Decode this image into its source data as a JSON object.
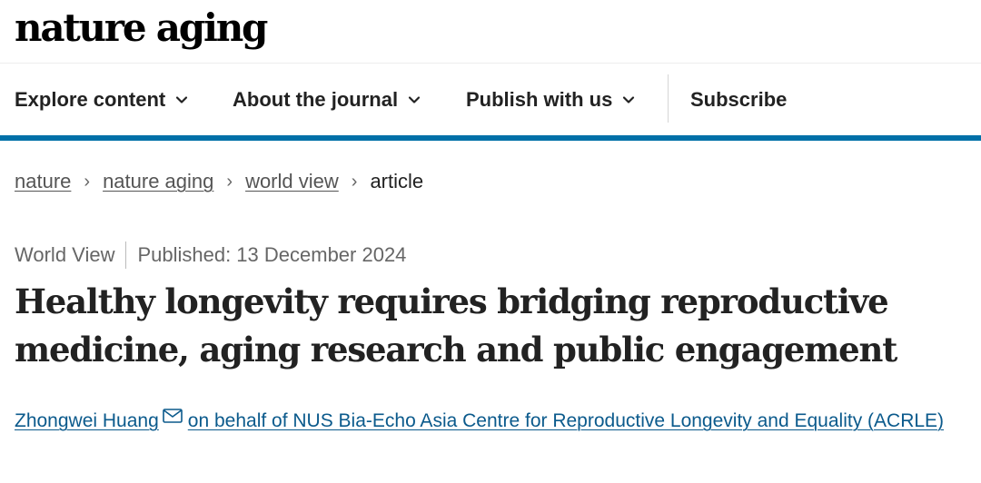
{
  "header": {
    "logo": "nature aging"
  },
  "nav": {
    "items": [
      {
        "label": "Explore content",
        "has_dropdown": true
      },
      {
        "label": "About the journal",
        "has_dropdown": true
      },
      {
        "label": "Publish with us",
        "has_dropdown": true
      },
      {
        "label": "Subscribe",
        "has_dropdown": false
      }
    ],
    "accent_color": "#0070a8"
  },
  "breadcrumb": {
    "items": [
      "nature",
      "nature aging",
      "world view"
    ],
    "current": "article",
    "separator": "›"
  },
  "article": {
    "type": "World View",
    "published": "Published: 13 December 2024",
    "title": "Healthy longevity requires bridging reproductive medicine, aging research and public engagement",
    "authors": {
      "primary": "Zhongwei Huang",
      "primary_icon": "mail-icon",
      "group": "on behalf of NUS Bia-Echo Asia Centre for Reproductive Longevity and Equality (ACRLE)",
      "link_color": "#0b5a8c"
    }
  }
}
